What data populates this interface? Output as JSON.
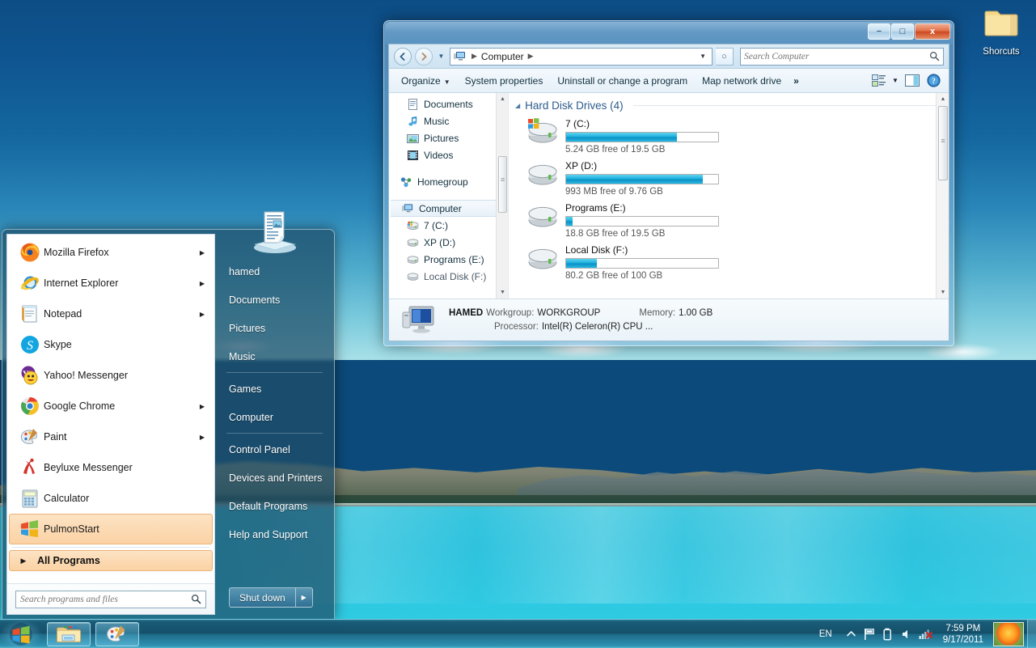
{
  "desktop": {
    "icons": [
      {
        "label": "Shorcuts",
        "icon": "folder-icon"
      }
    ]
  },
  "explorer": {
    "title": "",
    "window_buttons": {
      "minimize": "−",
      "maximize": "□",
      "close": "x"
    },
    "address": {
      "back_icon": "back-arrow-icon",
      "forward_icon": "forward-arrow-icon",
      "history_icon": "chevron-down-icon",
      "computer_icon": "computer-icon",
      "crumbs": [
        "Computer"
      ],
      "dropdown_icon": "chevron-down-icon",
      "refresh_icon": "refresh-icon",
      "refresh_glyph": "○"
    },
    "search": {
      "placeholder": "Search Computer",
      "value": "",
      "icon": "search-icon"
    },
    "toolbar": {
      "organize": "Organize",
      "system_properties": "System properties",
      "uninstall": "Uninstall or change a program",
      "map_network_drive": "Map network drive",
      "overflow": "»",
      "view_icon": "view-options-icon",
      "view_caret": "▼",
      "preview_pane_icon": "preview-pane-icon",
      "help_icon": "help-icon"
    },
    "nav_pane": {
      "items": [
        {
          "label": "Documents",
          "icon": "documents-icon",
          "indent": true,
          "selected": false
        },
        {
          "label": "Music",
          "icon": "music-icon",
          "indent": true,
          "selected": false
        },
        {
          "label": "Pictures",
          "icon": "pictures-icon",
          "indent": true,
          "selected": false
        },
        {
          "label": "Videos",
          "icon": "videos-icon",
          "indent": true,
          "selected": false
        }
      ],
      "homegroup": {
        "label": "Homegroup",
        "icon": "homegroup-icon"
      },
      "computer": {
        "label": "Computer",
        "icon": "computer-icon",
        "selected": true
      },
      "drives": [
        {
          "label": "7 (C:)",
          "icon": "windows-drive-icon"
        },
        {
          "label": "XP (D:)",
          "icon": "drive-icon"
        },
        {
          "label": "Programs (E:)",
          "icon": "drive-icon"
        },
        {
          "label": "Local Disk (F:)",
          "icon": "drive-icon"
        }
      ],
      "scroll_up_icon": "scroll-up-arrow",
      "scroll_down_icon": "scroll-down-arrow"
    },
    "content": {
      "group_title": "Hard Disk Drives (4)",
      "group_collapse_icon": "triangle-down-icon",
      "drives": [
        {
          "name": "7 (C:)",
          "capacity_text": "5.24 GB free of 19.5 GB",
          "used_percent": 73,
          "icon": "windows-drive-icon"
        },
        {
          "name": "XP (D:)",
          "capacity_text": "993 MB free of 9.76 GB",
          "used_percent": 90,
          "icon": "drive-icon"
        },
        {
          "name": "Programs (E:)",
          "capacity_text": "18.8 GB free of 19.5 GB",
          "used_percent": 4,
          "icon": "drive-icon"
        },
        {
          "name": "Local Disk (F:)",
          "capacity_text": "80.2 GB free of 100 GB",
          "used_percent": 20,
          "icon": "drive-icon"
        }
      ]
    },
    "details": {
      "computer_icon": "monitor-icon",
      "machine_name": "HAMED",
      "workgroup_label": "Workgroup:",
      "workgroup_value": "WORKGROUP",
      "memory_label": "Memory:",
      "memory_value": "1.00 GB",
      "processor_label": "Processor:",
      "processor_value": "Intel(R) Celeron(R) CPU ..."
    }
  },
  "start_menu": {
    "programs": [
      {
        "label": "Mozilla Firefox",
        "icon": "firefox-icon",
        "has_submenu": true
      },
      {
        "label": "Internet Explorer",
        "icon": "internet-explorer-icon",
        "has_submenu": true
      },
      {
        "label": "Notepad",
        "icon": "notepad-icon",
        "has_submenu": true
      },
      {
        "label": "Skype",
        "icon": "skype-icon",
        "has_submenu": false
      },
      {
        "label": "Yahoo! Messenger",
        "icon": "yahoo-messenger-icon",
        "has_submenu": false
      },
      {
        "label": "Google Chrome",
        "icon": "google-chrome-icon",
        "has_submenu": true
      },
      {
        "label": "Paint",
        "icon": "paint-icon",
        "has_submenu": true
      },
      {
        "label": "Beyluxe Messenger",
        "icon": "beyluxe-messenger-icon",
        "has_submenu": false
      },
      {
        "label": "Calculator",
        "icon": "calculator-icon",
        "has_submenu": false
      },
      {
        "label": "PulmonStart",
        "icon": "windows-logo-icon",
        "has_submenu": false,
        "highlighted": true
      }
    ],
    "all_programs": {
      "label": "All Programs",
      "icon": "triangle-right-icon"
    },
    "search": {
      "placeholder": "Search programs and files",
      "value": "",
      "icon": "search-icon"
    },
    "user": {
      "name": "hamed",
      "avatar_icon": "document-avatar-icon"
    },
    "right_items": [
      {
        "label": "Documents",
        "divider_after": false
      },
      {
        "label": "Pictures",
        "divider_after": false
      },
      {
        "label": "Music",
        "divider_after": true
      },
      {
        "label": "Games",
        "divider_after": false
      },
      {
        "label": "Computer",
        "divider_after": true
      },
      {
        "label": "Control Panel",
        "divider_after": false
      },
      {
        "label": "Devices and Printers",
        "divider_after": false
      },
      {
        "label": "Default Programs",
        "divider_after": false
      },
      {
        "label": "Help and Support",
        "divider_after": false
      }
    ],
    "shutdown": {
      "label": "Shut down",
      "arrow_icon": "triangle-right-icon"
    }
  },
  "taskbar": {
    "start_button": {
      "icon": "windows-start-orb"
    },
    "tasks": [
      {
        "icon": "explorer-folder-icon",
        "name": "windows-explorer"
      },
      {
        "icon": "paint-palette-icon",
        "name": "paint"
      }
    ],
    "tray": {
      "language": "EN",
      "show_hidden_icon": "chevron-up-icon",
      "icons": [
        "action-center-flag-icon",
        "battery-icon",
        "volume-icon",
        "network-error-icon"
      ],
      "clock_time": "7:59 PM",
      "clock_date": "9/17/2011",
      "thumbnail_icon": "flower-thumbnail",
      "show_desktop_icon": "show-desktop-button"
    }
  },
  "colors": {
    "accent": "#1eb0dd",
    "water": "#2ec6e0",
    "sky": "#14679f",
    "highlight_orange": "#fbd2a4",
    "close_red": "#cd4820"
  }
}
